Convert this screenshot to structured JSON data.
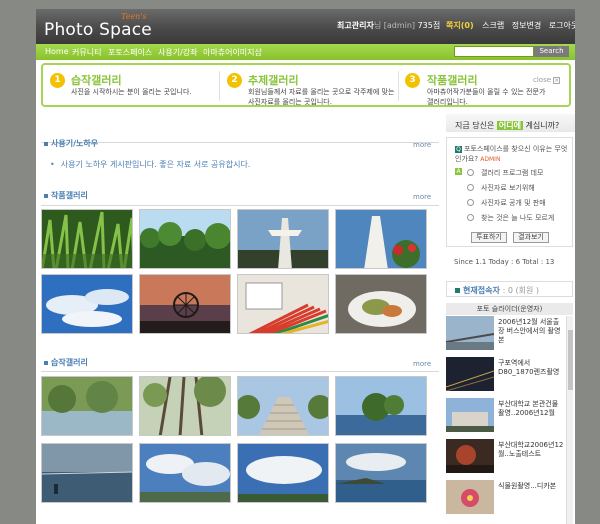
{
  "header": {
    "logo_small": "Teen's",
    "logo": "Photo Space",
    "user_name": "최고관리자",
    "user_suffix": "님 [admin]",
    "points": "735점",
    "note_label": "쪽지(0)",
    "links": [
      "스크랩",
      "정보변경",
      "로그아웃"
    ]
  },
  "nav": {
    "items": [
      "Home",
      "커뮤니티",
      "포토스페이스",
      "사용기/강좌",
      "아마츄어이미지샵"
    ],
    "search_placeholder": "",
    "search_button": "Search"
  },
  "promo": {
    "items": [
      {
        "num": "1",
        "title": "습작갤러리",
        "desc": "사진을 시작하시는 분이 올리는 곳입니다."
      },
      {
        "num": "2",
        "title": "추제갤러리",
        "desc": "회원님들께서 자료를 올리는 곳으로 각주제에 맞는 사진자료를 올리는 곳입니다."
      },
      {
        "num": "3",
        "title": "작품갤러리",
        "desc": "아마츄어작가분들이 올릴 수 있는 전문가갤러리입니다."
      }
    ],
    "close_label": "close"
  },
  "usage": {
    "title": "사용기/노하우",
    "more": "more",
    "notice": "사용기 노하우 게시판입니다. 좋은 자료 서로 공유합시다."
  },
  "gallery1": {
    "title": "작품갤러리",
    "more": "more",
    "photos": [
      "grass",
      "forest",
      "tower",
      "tower2",
      "sky",
      "ferris",
      "pencils",
      "food"
    ]
  },
  "gallery2": {
    "title": "습작갤러리",
    "more": "more",
    "photos": [
      "river",
      "trees",
      "stairs",
      "island",
      "sea",
      "clouds",
      "sky2",
      "coast"
    ]
  },
  "right": {
    "question_prefix": "지금 당신은",
    "question_highlight": "어디에",
    "question_suffix": "계십니까?",
    "poll": {
      "q_badge": "Q",
      "question": "포토스페이스를 찾으신 이유는 무엇인가요?",
      "admin": "ADMIN",
      "a_badge": "A",
      "options": [
        "갤러리 프로그램 데모",
        "사진자료 보기위해",
        "사진자료 공개 및 판매",
        "찾는 것은 늘 나도 모르게"
      ],
      "vote_btn": "투표하기",
      "result_btn": "결과보기"
    },
    "since": "Since 1.1 Today : 6 Total : 13",
    "current": {
      "label": "현재접속자",
      "count": ": 0 (회원 )"
    },
    "slide": {
      "header": "포토 슬라이더(운영자)",
      "items": [
        {
          "caption": "2006년12월 서울출장 버스안에서의 촬영본"
        },
        {
          "caption": "구포역에서 D80_1870렌즈촬영"
        },
        {
          "caption": "부산대학교 본관건물촬영..2006년12월"
        },
        {
          "caption": "부산대학교2006년12월..노출테스트"
        },
        {
          "caption": "식물원촬영...디카본"
        }
      ]
    }
  }
}
